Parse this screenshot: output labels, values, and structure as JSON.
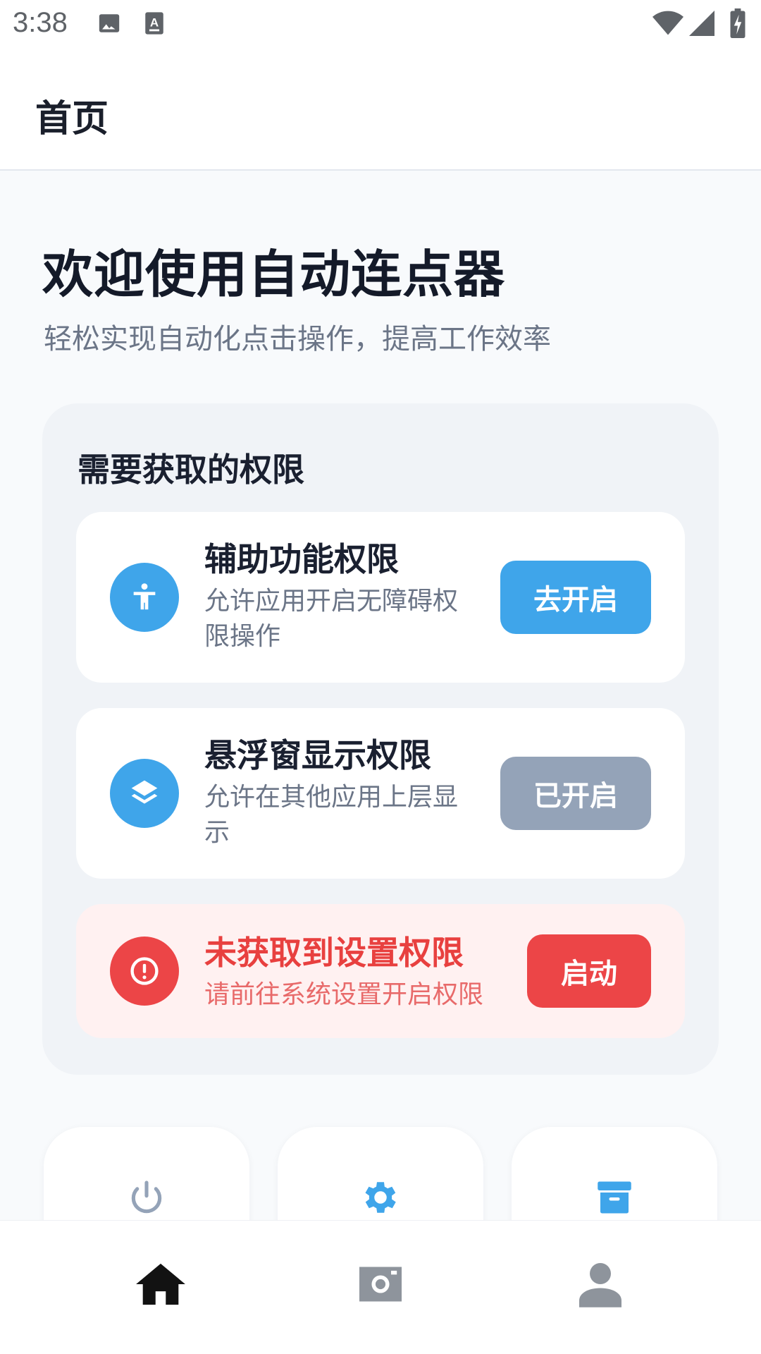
{
  "status_bar": {
    "time": "3:38",
    "icons": [
      "image-icon",
      "keyboard-a-icon",
      "wifi-icon",
      "signal-icon",
      "battery-charging-icon"
    ]
  },
  "app_bar": {
    "title": "首页"
  },
  "hero": {
    "title": "欢迎使用自动连点器",
    "subtitle": "轻松实现自动化点击操作，提高工作效率"
  },
  "permissions": {
    "title": "需要获取的权限",
    "items": [
      {
        "icon": "accessibility-icon",
        "title": "辅助功能权限",
        "desc": "允许应用开启无障碍权限操作",
        "button": "去开启",
        "button_color": "#3fa5ea"
      },
      {
        "icon": "layers-icon",
        "title": "悬浮窗显示权限",
        "desc": "允许在其他应用上层显示",
        "button": "已开启",
        "button_color": "#94a3b8"
      }
    ],
    "error": {
      "icon": "alert-circle-icon",
      "title": "未获取到设置权限",
      "desc": "请前往系统设置开启权限",
      "button": "启动",
      "button_color": "#ec4547"
    }
  },
  "tiles": [
    {
      "icon": "power-icon",
      "color": "#94a3b8"
    },
    {
      "icon": "gear-icon",
      "color": "#3fa5ea"
    },
    {
      "icon": "archive-icon",
      "color": "#3fa5ea"
    }
  ],
  "bottom_nav": [
    {
      "icon": "home-icon",
      "active": true
    },
    {
      "icon": "camera-icon",
      "active": false
    },
    {
      "icon": "person-icon",
      "active": false
    }
  ],
  "colors": {
    "accent": "#3fa5ea",
    "danger": "#ec4547",
    "disabled": "#94a3b8"
  }
}
